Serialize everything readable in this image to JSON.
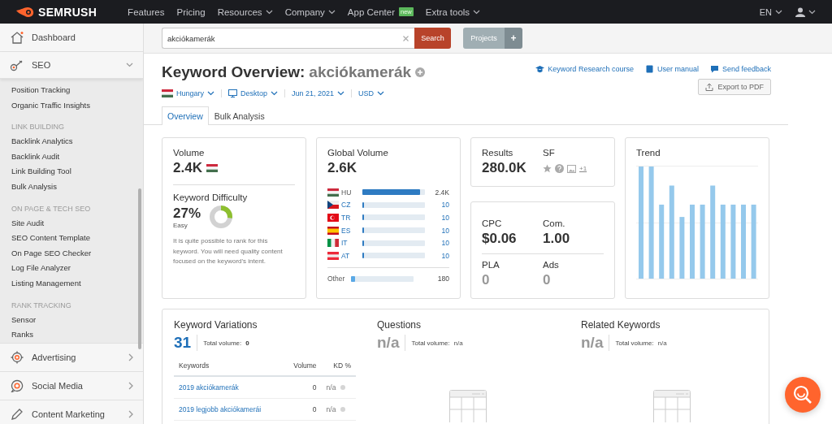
{
  "top_nav": {
    "logo": "SEMRUSH",
    "items": [
      {
        "label": "Features",
        "dropdown": false
      },
      {
        "label": "Pricing",
        "dropdown": false
      },
      {
        "label": "Resources",
        "dropdown": true
      },
      {
        "label": "Company",
        "dropdown": true
      },
      {
        "label": "App Center",
        "dropdown": false,
        "badge": "new"
      },
      {
        "label": "Extra tools",
        "dropdown": true
      }
    ],
    "language": "EN"
  },
  "sidebar": {
    "items": [
      {
        "label": "Dashboard",
        "kind": "link"
      },
      {
        "label": "SEO",
        "kind": "group",
        "expanded": true,
        "children": [
          {
            "kind": "link",
            "label": "Position Tracking"
          },
          {
            "kind": "link",
            "label": "Organic Traffic Insights"
          },
          {
            "kind": "heading",
            "label": "LINK BUILDING"
          },
          {
            "kind": "link",
            "label": "Backlink Analytics"
          },
          {
            "kind": "link",
            "label": "Backlink Audit"
          },
          {
            "kind": "link",
            "label": "Link Building Tool"
          },
          {
            "kind": "link",
            "label": "Bulk Analysis"
          },
          {
            "kind": "heading",
            "label": "ON PAGE & TECH SEO"
          },
          {
            "kind": "link",
            "label": "Site Audit"
          },
          {
            "kind": "link",
            "label": "SEO Content Template"
          },
          {
            "kind": "link",
            "label": "On Page SEO Checker"
          },
          {
            "kind": "link",
            "label": "Log File Analyzer"
          },
          {
            "kind": "link",
            "label": "Listing Management"
          },
          {
            "kind": "heading",
            "label": "RANK TRACKING"
          },
          {
            "kind": "link",
            "label": "Sensor"
          },
          {
            "kind": "link",
            "label": "Ranks"
          }
        ]
      },
      {
        "label": "Advertising",
        "kind": "group",
        "expanded": false
      },
      {
        "label": "Social Media",
        "kind": "group",
        "expanded": false
      },
      {
        "label": "Content Marketing",
        "kind": "group",
        "expanded": false
      }
    ]
  },
  "search": {
    "value": "akciókamerák",
    "button": "Search"
  },
  "projects": {
    "label": "Projects",
    "add": "+"
  },
  "header": {
    "title": "Keyword Overview:",
    "keyword": "akciókamerák",
    "links": [
      "Keyword Research course",
      "User manual",
      "Send feedback"
    ],
    "export_button": "Export to PDF",
    "filters": [
      "Hungary",
      "Desktop",
      "Jun 21, 2021",
      "USD"
    ]
  },
  "tabs": [
    {
      "label": "Overview",
      "selected": true
    },
    {
      "label": "Bulk Analysis",
      "selected": false
    }
  ],
  "volume": {
    "title": "Volume",
    "value": "2.4K"
  },
  "difficulty": {
    "title": "Keyword Difficulty",
    "value": "27%",
    "rating": "Easy",
    "description": "It is quite possible to rank for this keyword. You will need quality content focused on the keyword's intent."
  },
  "global_volume": {
    "title": "Global Volume",
    "value": "2.6K",
    "countries": [
      {
        "code": "HU",
        "level": 0.92,
        "value": "2.4K",
        "linked": false
      },
      {
        "code": "CZ",
        "level": 0.03,
        "value": "10",
        "linked": true
      },
      {
        "code": "TR",
        "level": 0.03,
        "value": "10",
        "linked": true
      },
      {
        "code": "ES",
        "level": 0.03,
        "value": "10",
        "linked": true
      },
      {
        "code": "IT",
        "level": 0.03,
        "value": "10",
        "linked": true
      },
      {
        "code": "AT",
        "level": 0.03,
        "value": "10",
        "linked": true
      }
    ],
    "other": {
      "label": "Other",
      "level": 0.06,
      "value": "180"
    }
  },
  "serp": {
    "results_label": "Results",
    "results": "280.0K",
    "sf_label": "SF",
    "sf_more": "+1"
  },
  "cost": {
    "metrics": [
      {
        "label": "CPC",
        "value": "$0.06",
        "muted": false
      },
      {
        "label": "Com.",
        "value": "1.00",
        "muted": false
      },
      {
        "label": "PLA",
        "value": "0",
        "muted": true
      },
      {
        "label": "Ads",
        "value": "0",
        "muted": true
      }
    ]
  },
  "trend": {
    "title": "Trend"
  },
  "panels": [
    {
      "title": "Keyword Variations",
      "count": "31",
      "available": true,
      "total_label": "Total volume:",
      "total": "0",
      "table": {
        "columns": [
          "Keywords",
          "Volume",
          "KD %"
        ],
        "rows": [
          {
            "keyword": "2019 akciókamerák",
            "volume": "0",
            "kd": "n/a"
          },
          {
            "keyword": "2019 legjobb akciókamerái",
            "volume": "0",
            "kd": "n/a"
          }
        ]
      }
    },
    {
      "title": "Questions",
      "count": "n/a",
      "available": false,
      "total_label": "Total volume:",
      "total": "n/a"
    },
    {
      "title": "Related Keywords",
      "count": "n/a",
      "available": false,
      "total_label": "Total volume:",
      "total": "n/a"
    }
  ]
}
